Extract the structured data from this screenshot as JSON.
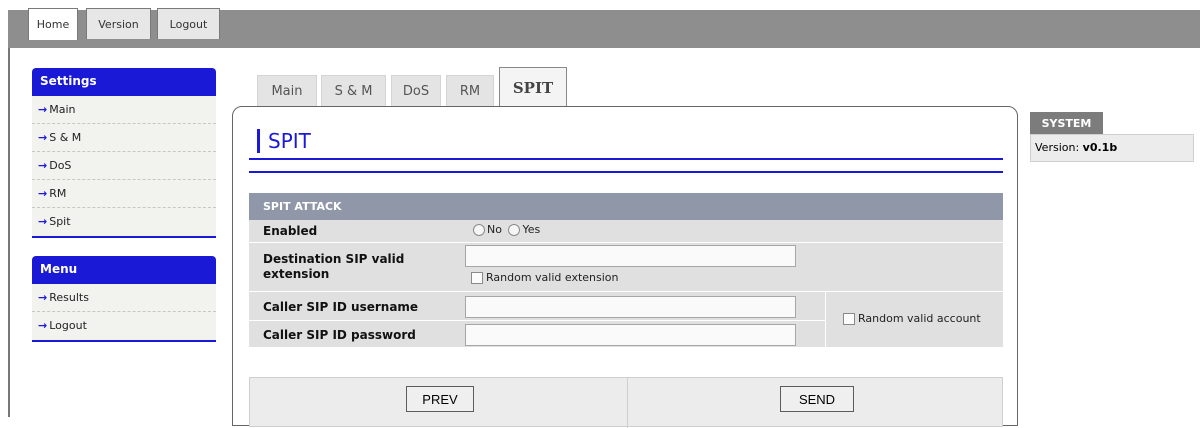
{
  "top_tabs": [
    "Home",
    "Version",
    "Logout"
  ],
  "sidebar": {
    "settings": {
      "title": "Settings",
      "items": [
        "Main",
        "S & M",
        "DoS",
        "RM",
        "Spit"
      ]
    },
    "menu": {
      "title": "Menu",
      "items": [
        "Results",
        "Logout"
      ]
    },
    "arrow": "→"
  },
  "content_tabs": [
    "Main",
    "S & M",
    "DoS",
    "RM",
    "SPIT"
  ],
  "active_content_tab": "SPIT",
  "panel": {
    "title": "SPIT",
    "section": "SPIT ATTACK",
    "enabled_label": "Enabled",
    "enabled_options": [
      "No",
      "Yes"
    ],
    "dest_label_line1": "Destination SIP valid",
    "dest_label_line2": "extension",
    "dest_value": "",
    "random_extension_label": "Random valid extension",
    "caller_user_label": "Caller SIP ID username",
    "caller_user_value": "",
    "caller_pass_label": "Caller SIP ID password",
    "caller_pass_value": "",
    "random_account_label": "Random valid account",
    "prev_label": "PREV",
    "send_label": "SEND"
  },
  "system": {
    "title": "SYSTEM",
    "version_label": "Version:",
    "version_value": "v0.1b"
  },
  "colors": {
    "accent": "#1a1ad6",
    "top_band": "#8e8e8e",
    "section_head": "#8f97a8"
  }
}
